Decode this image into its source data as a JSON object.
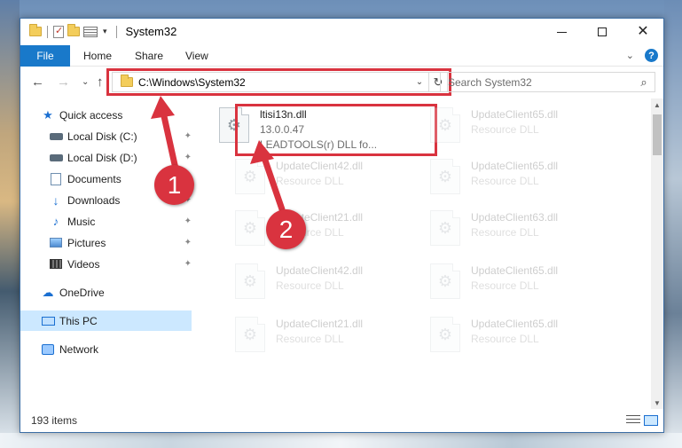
{
  "window": {
    "title": "System32",
    "controls": {
      "minimize": "—",
      "maximize": "□",
      "close": "✕"
    }
  },
  "ribbon": {
    "tabs": [
      "File",
      "Home",
      "Share",
      "View"
    ],
    "help": "?",
    "expand": "⌄"
  },
  "address": {
    "path": "C:\\Windows\\System32",
    "refresh": "↻",
    "dropdown": "⌄",
    "back": "←",
    "forward": "→",
    "recent": "⌄",
    "up": "↑"
  },
  "search": {
    "placeholder": "Search System32",
    "icon": "⌕"
  },
  "sidebar": {
    "items": [
      {
        "label": "Quick access",
        "icon": "star-icon"
      },
      {
        "label": "Local Disk (C:)",
        "icon": "drive-icon"
      },
      {
        "label": "Local Disk (D:)",
        "icon": "drive-icon"
      },
      {
        "label": "Documents",
        "icon": "documents-icon"
      },
      {
        "label": "Downloads",
        "icon": "download-icon"
      },
      {
        "label": "Music",
        "icon": "music-icon"
      },
      {
        "label": "Pictures",
        "icon": "pictures-icon"
      },
      {
        "label": "Videos",
        "icon": "videos-icon"
      },
      {
        "label": "OneDrive",
        "icon": "cloud-icon"
      },
      {
        "label": "This PC",
        "icon": "computer-icon"
      },
      {
        "label": "Network",
        "icon": "network-icon"
      }
    ],
    "pin": "📌"
  },
  "files": [
    {
      "name": "ltisi13n.dll",
      "line2": "13.0.0.47",
      "line3": "LEADTOOLS(r) DLL fo..."
    },
    {
      "name": "UpdateClient65.dll",
      "line2": "Resource DLL"
    },
    {
      "name": "UpdateClient42.dll",
      "line2": "Resource DLL"
    },
    {
      "name": "UpdateClient65.dll",
      "line2": "Resource DLL"
    },
    {
      "name": "UpdateClient21.dll",
      "line2": "Resource DLL"
    },
    {
      "name": "UpdateClient63.dll",
      "line2": "Resource DLL"
    },
    {
      "name": "UpdateClient42.dll",
      "line2": "Resource DLL"
    },
    {
      "name": "UpdateClient65.dll",
      "line2": "Resource DLL"
    },
    {
      "name": "UpdateClient21.dll",
      "line2": "Resource DLL"
    },
    {
      "name": "UpdateClient65.dll",
      "line2": "Resource DLL"
    }
  ],
  "status": {
    "items": "193 items"
  },
  "callouts": {
    "one": "1",
    "two": "2"
  },
  "colors": {
    "accent": "#1979ca",
    "highlight": "#d9333f",
    "selected": "#cce8ff"
  }
}
